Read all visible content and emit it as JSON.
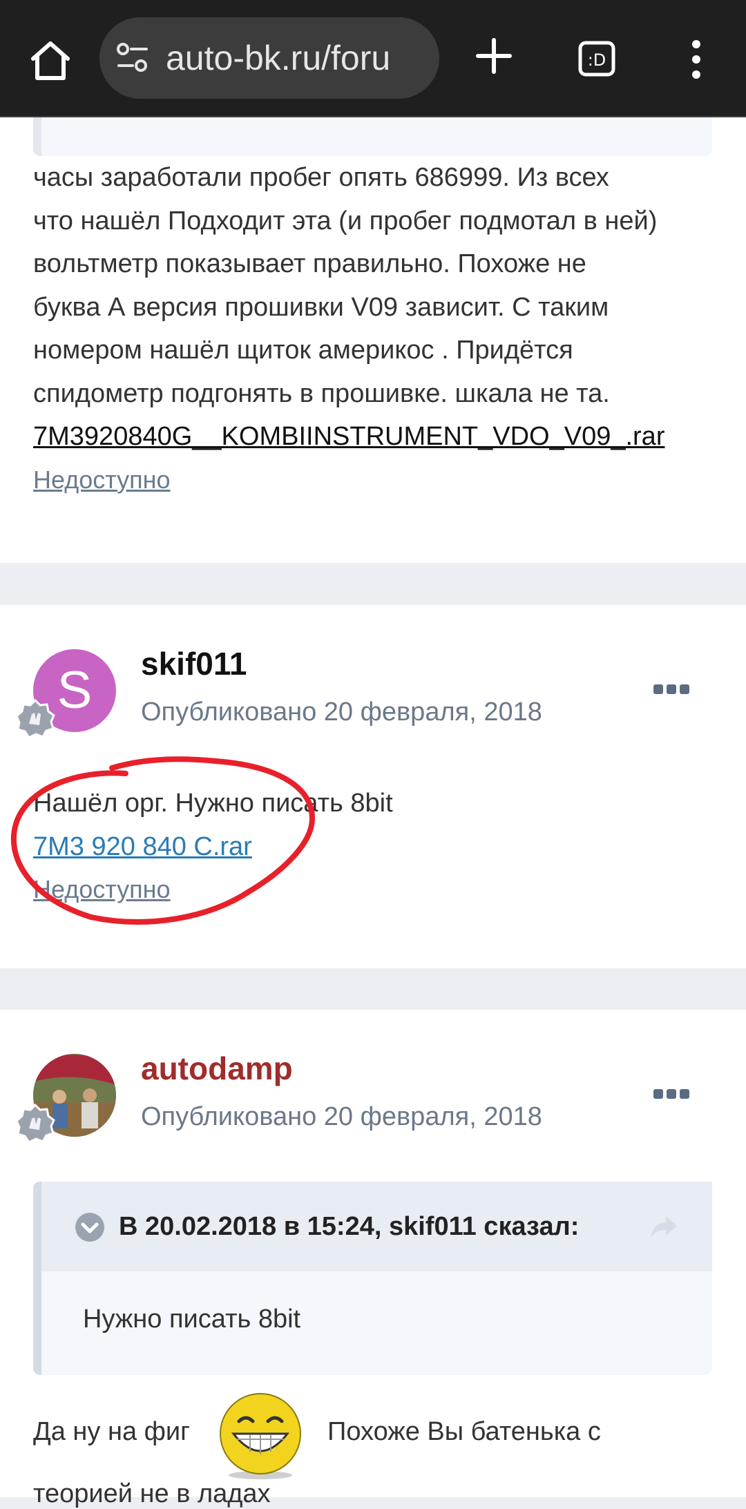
{
  "browser": {
    "url": "auto-bk.ru/foru",
    "icons": [
      "home-icon",
      "tune-icon",
      "plus-icon",
      "tabs-icon",
      "more-vert-icon"
    ]
  },
  "post1": {
    "lines": [
      "часы заработали пробег опять 686999. Из всех",
      "что нашёл Подходит эта (и пробег подмотал в ней)",
      "вольтметр показывает правильно. Похоже не",
      "буква А версия прошивки V09 зависит. С таким",
      "номером нашёл щиток америкос . Придётся",
      "спидометр подгонять в прошивке. шкала не та."
    ],
    "file_link": "7M3920840G__KOMBIINSTRUMENT_VDO_V09_.rar",
    "unavailable": "Недоступно"
  },
  "post2": {
    "avatar_letter": "S",
    "author": "skif011",
    "date": "Опубликовано 20 февраля, 2018",
    "text": "Нашёл орг. Нужно писать 8bit",
    "file_link": "7M3 920 840 C.rar",
    "unavailable": "Недоступно",
    "colors": {
      "avatar": "#c864c3",
      "link": "#2a7bb5",
      "circle": "#e8202a"
    }
  },
  "post3": {
    "author": "autodamp",
    "date": "Опубликовано 20 февраля, 2018",
    "quote_citation": "В 20.02.2018 в 15:24, skif011 сказал:",
    "quote_text": "Нужно писать 8bit",
    "reply_start": "Да ну на фиг",
    "reply_end": "Похоже Вы батенька с",
    "reply_next": "теорией не в ладах",
    "colors": {
      "author": "#a02c2c"
    }
  }
}
